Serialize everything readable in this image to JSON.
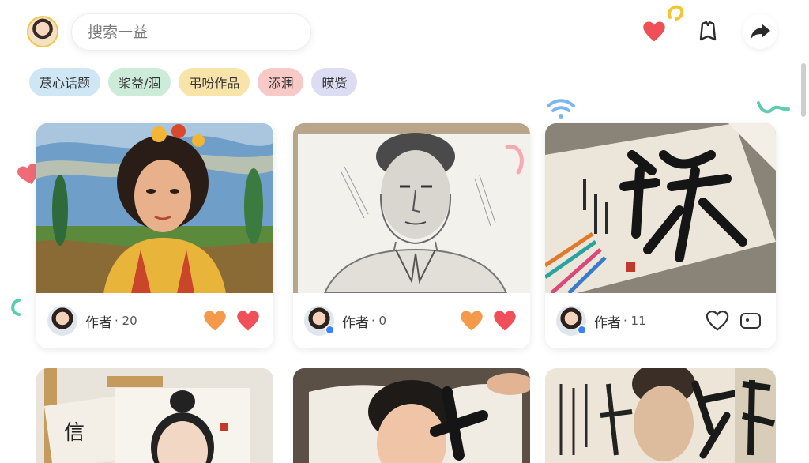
{
  "header": {
    "search_placeholder": "搜索一益",
    "icons": [
      "avatar",
      "heart-icon",
      "bookmark-icon",
      "share-icon"
    ]
  },
  "chips": [
    {
      "label": "荩心话题",
      "color": "#cfe6f5"
    },
    {
      "label": "桨益/涸",
      "color": "#cdebd9"
    },
    {
      "label": "弔吩作品",
      "color": "#f8e3a9"
    },
    {
      "label": "添涠",
      "color": "#f7c9c7"
    },
    {
      "label": "暎赀",
      "color": "#dcdcf3"
    }
  ],
  "cards": [
    {
      "author": "作者",
      "count": "· 20",
      "image": "oil-painting-portrait",
      "actions": [
        "orange-heart-icon",
        "red-heart-icon"
      ]
    },
    {
      "author": "作者",
      "count": "· 0",
      "image": "pencil-sketch-portrait",
      "actions": [
        "orange-heart-icon",
        "red-heart-icon"
      ]
    },
    {
      "author": "作者",
      "count": "· 11",
      "image": "calligraphy-artwork",
      "actions": [
        "outline-heart-icon",
        "comment-icon"
      ]
    }
  ],
  "cards_row2": [
    {
      "image": "ink-portrait-calligraphy"
    },
    {
      "image": "ink-face-sketch"
    },
    {
      "image": "calligraphy-scroll-portrait"
    }
  ],
  "colors": {
    "accent_red": "#f0505a",
    "accent_orange": "#f59a4a",
    "chip_text": "#333333"
  }
}
